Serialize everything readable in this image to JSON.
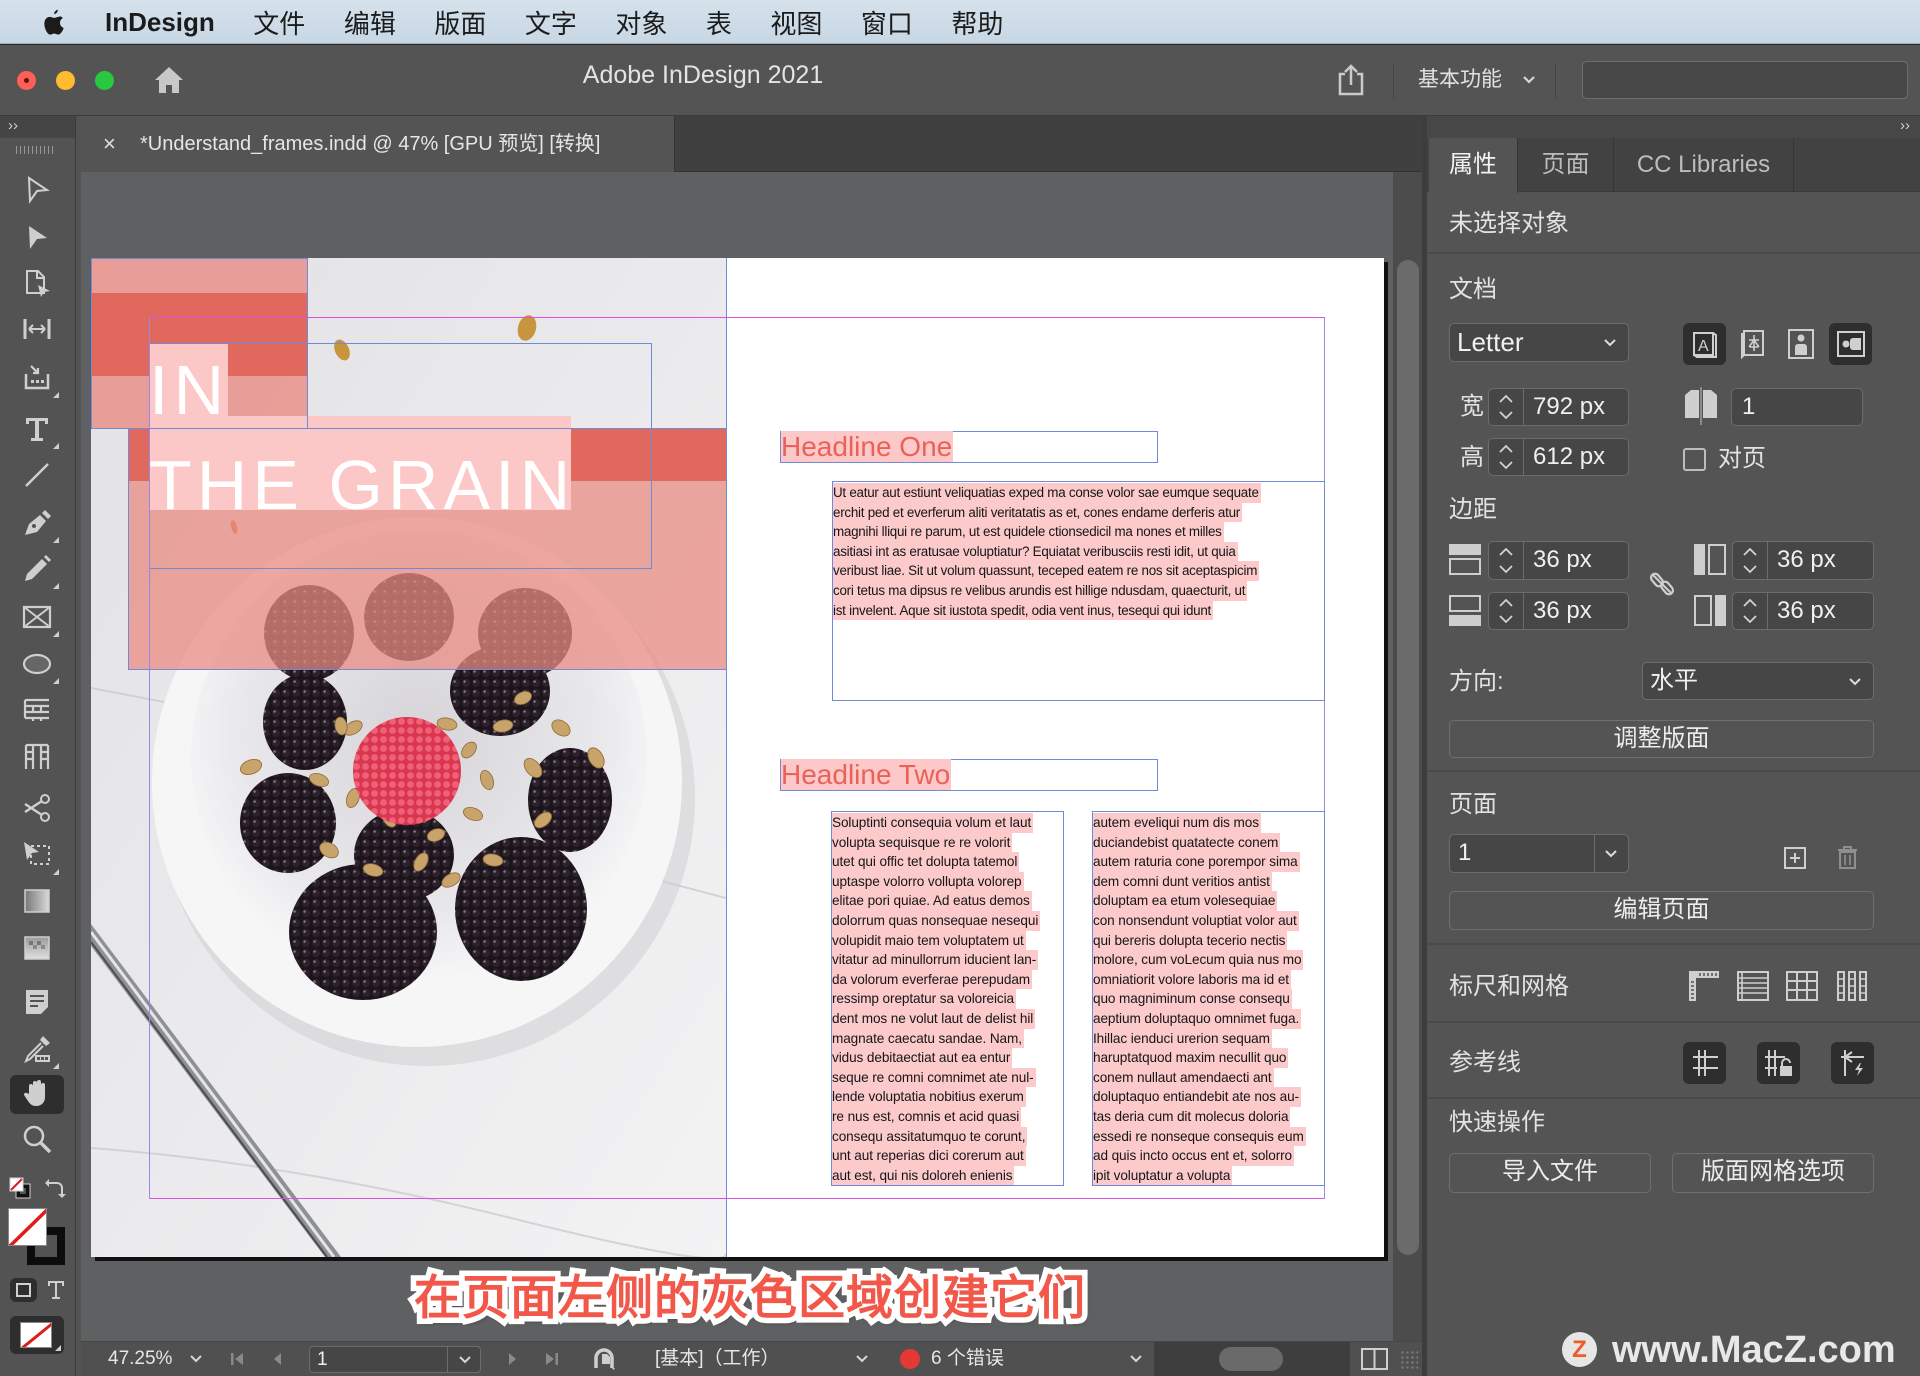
{
  "menubar": {
    "app_name": "InDesign",
    "items": [
      "文件",
      "编辑",
      "版面",
      "文字",
      "对象",
      "表",
      "视图",
      "窗口",
      "帮助"
    ]
  },
  "titlebar": {
    "title": "Adobe InDesign 2021",
    "workspace": "基本功能",
    "search_value": ""
  },
  "toolbar": {
    "collapse_label": "››",
    "tools": [
      "选择工具",
      "直接选择工具",
      "页面工具",
      "间隙工具",
      "内容收集器工具",
      "文字工具",
      "直线工具",
      "钢笔工具",
      "铅笔工具",
      "矩形框架工具",
      "椭圆工具",
      "水平网格工具",
      "垂直网格工具",
      "剪刀工具",
      "自由变换工具",
      "渐变色板工具",
      "渐变羽化工具",
      "附注工具",
      "吸管工具",
      "抓手工具",
      "缩放显示工具",
      "默认填色和描边",
      "填色和描边",
      "格式针对容器",
      "应用无"
    ],
    "active_tool": "抓手工具"
  },
  "document_tab": {
    "close_label": "×",
    "title": "*Understand_frames.indd @ 47% [GPU 预览] [转换]"
  },
  "page": {
    "title_line1": "IN",
    "title_line2": "THE GRAIN",
    "headline_one": "Headline One",
    "body_one_lines": [
      "Ut eatur aut estiunt veliquatias exped ma conse volor sae eumque sequate",
      "erchit ped et everferum aliti veritatatis as et, cones endame derferis atur",
      "magnihi lliqui re parum, ut est quidele ctionsedicil ma nones et milles",
      "asitiasi int as eratusae voluptiatur? Equiatat veribusciis resti idit, ut quia",
      "veribust liae. Sit ut volum quassunt, teceped eatem re nos sit aceptaspicim",
      "cori tetus ma dipsus re velibus arundis est hillige ndusdam, quaecturit, ut",
      "ist invelent. Aque sit iustota spedit, odia vent inus, tesequi qui idunt"
    ],
    "headline_two": "Headline Two",
    "col1_lines": [
      "Soluptinti consequia volum et laut",
      "volupta sequisque re re volorit",
      "utet qui offic tet dolupta tatemol",
      "uptaspe volorro vollupta volorep",
      "elitae pori quiae. Ad eatus demos",
      "dolorrum quas nonsequae nesequi",
      "volupidit maio tem voluptatem ut",
      "vitatur ad minullorrum iducient lan-",
      "da volorum everferae perepudam",
      "ressimp oreptatur sa voloreicia",
      "dent mos ne volut laut de delist hil",
      "magnate caecatu sandae. Nam,",
      "vidus debitaectiat aut ea entur",
      "seque re comni comnimet ate nul-",
      "lende voluptatia nobitius exerum",
      "re nus est, comnis et acid quasi",
      "consequ assitatumquo te corunt,",
      "unt aut reperias dici corerum aut",
      "aut est, qui nis doloreh enienis"
    ],
    "col2_lines": [
      "autem eveliqui num dis mos",
      "duciandebist quatatecte conem",
      "autem raturia cone porempor sima",
      "dem comni dunt veritios antist",
      "doluptam ea etum volesequiae",
      "con nonsendunt voluptiat volor aut",
      "qui bereris dolupta tecerio nectis",
      "molore, cum voLecum quia nus mo",
      "omniatiorit volore laboris ma id et",
      "quo magniminum conse consequ",
      "aeptium doluptaquo omnimet fuga.",
      "Ihillac ienduci urerion sequam",
      "haruptatquod maxim necullit quo",
      "conem nullaut amendaecti ant",
      "doluptaquo entiandebit ate nos au-",
      "tas deria cum dit molecus doloria",
      "essedi re nonseque consequis eum",
      "ad quis incto occus ent et, solorro",
      "ipit voluptatur a volupta"
    ]
  },
  "caption": "在页面左侧的灰色区域创建它们",
  "panel": {
    "collapse_label": "››",
    "tabs": [
      "属性",
      "页面",
      "CC Libraries"
    ],
    "active_tab": "属性",
    "selection_status": "未选择对象",
    "document": {
      "heading": "文档",
      "preset": "Letter",
      "width_label": "宽",
      "width": "792 px",
      "height_label": "高",
      "height": "612 px",
      "page_count": "1",
      "facing_pages_label": "对页",
      "facing_pages_checked": false,
      "text_direction": "horizontal",
      "orientation": "landscape"
    },
    "margins": {
      "heading": "边距",
      "top": "36 px",
      "bottom": "36 px",
      "left": "36 px",
      "right": "36 px"
    },
    "binding": {
      "label": "方向:",
      "value": "水平"
    },
    "adjust_layout": "调整版面",
    "pages": {
      "heading": "页面",
      "current": "1",
      "edit_page": "编辑页面"
    },
    "rulers_grids": "标尺和网格",
    "guides": "参考线",
    "quick_actions": {
      "heading": "快速操作",
      "import_file": "导入文件",
      "layout_grid_options": "版面网格选项"
    }
  },
  "statusbar": {
    "zoom": "47.25%",
    "page": "1",
    "preflight_profile": "[基本]（工作）",
    "errors": "6 个错误"
  },
  "watermark": {
    "logo_letter": "Z",
    "text": "www.MacZ.com"
  },
  "colors": {
    "accent_red": "#e0685c",
    "light_pink": "#e9a39d",
    "text_highlight": "#fccaca",
    "headline": "#e8625a",
    "error_dot": "#e53935",
    "caption": "#f1584a",
    "margin_guide": "#e04ee0",
    "frame_edge": "#6f8ad9"
  }
}
